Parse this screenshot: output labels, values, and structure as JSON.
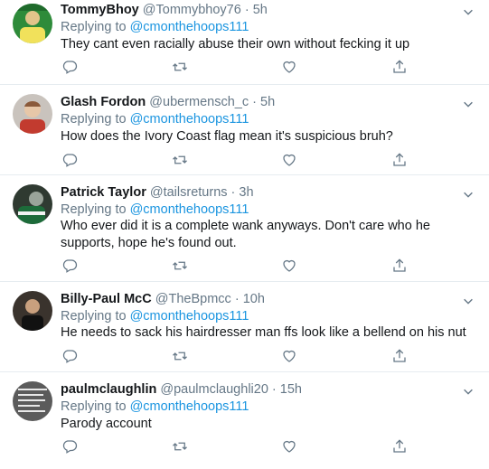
{
  "tweets": [
    {
      "name": "TommyBhoy",
      "handle": "@Tommybhoy76",
      "dot": "·",
      "time": "5h",
      "reply_prefix": "Replying to ",
      "reply_to": "@cmonthehoops111",
      "text": "They cant even racially abuse their own without fecking it up"
    },
    {
      "name": "Glash Fordon",
      "handle": "@ubermensch_c",
      "dot": "·",
      "time": "5h",
      "reply_prefix": "Replying to ",
      "reply_to": "@cmonthehoops111",
      "text": "How does the Ivory Coast flag mean it's suspicious bruh?"
    },
    {
      "name": "Patrick Taylor",
      "handle": "@tailsreturns",
      "dot": "·",
      "time": "3h",
      "reply_prefix": "Replying to ",
      "reply_to": "@cmonthehoops111",
      "text": "Who ever did it is a complete wank anyways. Don't care who he supports, hope he's found out."
    },
    {
      "name": "Billy-Paul McC",
      "handle": "@TheBpmcc",
      "dot": "·",
      "time": "10h",
      "reply_prefix": "Replying to ",
      "reply_to": "@cmonthehoops111",
      "text": "He needs to sack his hairdresser man ffs look like a bellend on his nut"
    },
    {
      "name": "paulmclaughlin",
      "handle": "@paulmclaughli20",
      "dot": "·",
      "time": "15h",
      "reply_prefix": "Replying to ",
      "reply_to": "@cmonthehoops111",
      "text": "Parody account"
    }
  ],
  "icons": {
    "reply": "reply-icon",
    "retweet": "retweet-icon",
    "like": "heart-icon",
    "share": "share-icon",
    "more": "chevron-down-icon"
  },
  "colors": {
    "link": "#1b95e0",
    "muted": "#657786",
    "border": "#e6ecf0"
  }
}
